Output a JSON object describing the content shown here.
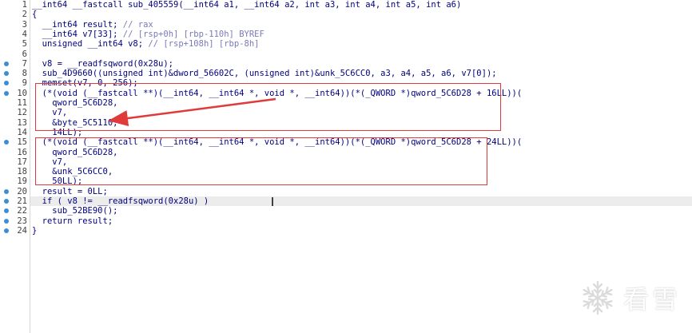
{
  "editor": {
    "lines": [
      {
        "num": "1",
        "dot": false,
        "text": "__int64 __fastcall sub_405559(__int64 a1, __int64 a2, int a3, int a4, int a5, int a6)"
      },
      {
        "num": "2",
        "dot": false,
        "text": "{"
      },
      {
        "num": "3",
        "dot": false,
        "text": "  __int64 result; // rax"
      },
      {
        "num": "4",
        "dot": false,
        "text": "  __int64 v7[33]; // [rsp+0h] [rbp-110h] BYREF"
      },
      {
        "num": "5",
        "dot": false,
        "text": "  unsigned __int64 v8; // [rsp+108h] [rbp-8h]"
      },
      {
        "num": "6",
        "dot": false,
        "text": ""
      },
      {
        "num": "7",
        "dot": true,
        "text": "  v8 = __readfsqword(0x28u);"
      },
      {
        "num": "8",
        "dot": true,
        "text": "  sub_4D9660((unsigned int)&dword_56602C, (unsigned int)&unk_5C6CC0, a3, a4, a5, a6, v7[0]);"
      },
      {
        "num": "9",
        "dot": true,
        "text": "  memset(v7, 0, 256);"
      },
      {
        "num": "10",
        "dot": true,
        "text": "  (*(void (__fastcall **)(__int64, __int64 *, void *, __int64))(*(_QWORD *)qword_5C6D28 + 16LL))("
      },
      {
        "num": "11",
        "dot": false,
        "text": "    qword_5C6D28,"
      },
      {
        "num": "12",
        "dot": false,
        "text": "    v7,"
      },
      {
        "num": "13",
        "dot": false,
        "text": "    &byte_5C5110,"
      },
      {
        "num": "14",
        "dot": false,
        "text": "    14LL);"
      },
      {
        "num": "15",
        "dot": true,
        "text": "  (*(void (__fastcall **)(__int64, __int64 *, void *, __int64))(*(_QWORD *)qword_5C6D28 + 24LL))("
      },
      {
        "num": "16",
        "dot": false,
        "text": "    qword_5C6D28,"
      },
      {
        "num": "17",
        "dot": false,
        "text": "    v7,"
      },
      {
        "num": "18",
        "dot": false,
        "text": "    &unk_5C6CC0,"
      },
      {
        "num": "19",
        "dot": false,
        "text": "    50LL);"
      },
      {
        "num": "20",
        "dot": true,
        "text": "  result = 0LL;"
      },
      {
        "num": "21",
        "dot": true,
        "text": "  if ( v8 != __readfsqword(0x28u) )"
      },
      {
        "num": "22",
        "dot": true,
        "text": "    sub_52BE90();"
      },
      {
        "num": "23",
        "dot": true,
        "text": "  return result;"
      },
      {
        "num": "24",
        "dot": true,
        "text": "}"
      }
    ]
  },
  "colors": {
    "code_text": "#000080",
    "comment": "#7a7ab8",
    "breakpoint_dot": "#3b8ed6",
    "highlight_box": "#e03a3a",
    "arrow": "#e03a3a"
  },
  "watermark": {
    "text": "看雪",
    "icon": "snowflake-icon"
  }
}
